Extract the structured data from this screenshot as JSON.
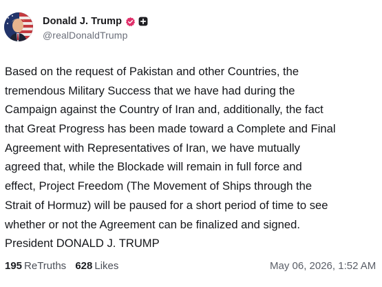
{
  "author": {
    "display_name": "Donald J. Trump",
    "handle": "@realDonaldTrump"
  },
  "icons": {
    "avatar": "profile-avatar",
    "verified": "verified-badge-icon",
    "plus": "plus-badge-icon"
  },
  "colors": {
    "verified": "#e0306a",
    "plus_badge": "#1f1f23"
  },
  "post": {
    "lines": [
      "Based on the request of Pakistan and other Countries, the",
      "tremendous Military Success that we have had during the",
      "Campaign against the Country of Iran and, additionally, the fact",
      "that Great Progress has been made toward a Complete and Final",
      "Agreement with Representatives of Iran, we have mutually",
      "agreed that, while the Blockade will remain in full force and",
      "effect, Project Freedom (The Movement of Ships through the",
      "Strait of Hormuz) will be paused for a short period of time to see",
      "whether or not the Agreement can be finalized and signed.",
      "President DONALD J. TRUMP"
    ]
  },
  "stats": {
    "retruths_count": "195",
    "retruths_label": "ReTruths",
    "likes_count": "628",
    "likes_label": "Likes"
  },
  "timestamp": "May 06, 2026, 1:52 AM"
}
